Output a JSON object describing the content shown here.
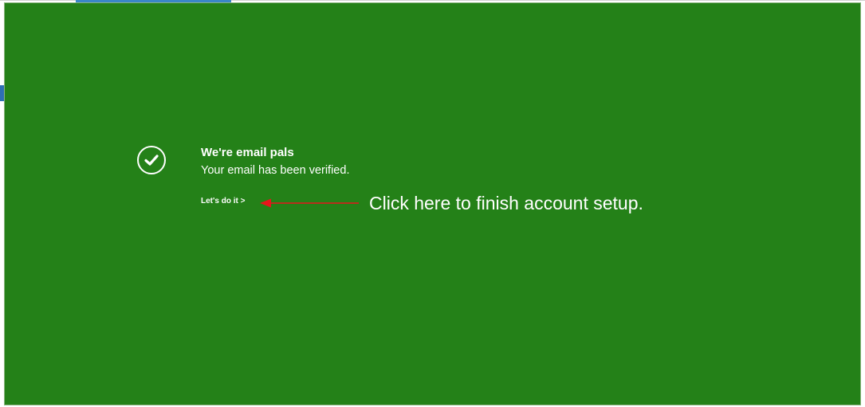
{
  "verification": {
    "title": "We're email pals",
    "message": "Your email has been verified.",
    "cta_label": "Let's do it >"
  },
  "annotation": {
    "text": "Click here to finish account setup."
  },
  "icons": {
    "status": "checkmark-circle-icon",
    "pointer": "red-arrow-left-icon"
  },
  "colors": {
    "panel_background": "#248118",
    "text": "#ffffff",
    "annotation_arrow": "#e8141c",
    "tab_accent": "#3a86c8"
  }
}
